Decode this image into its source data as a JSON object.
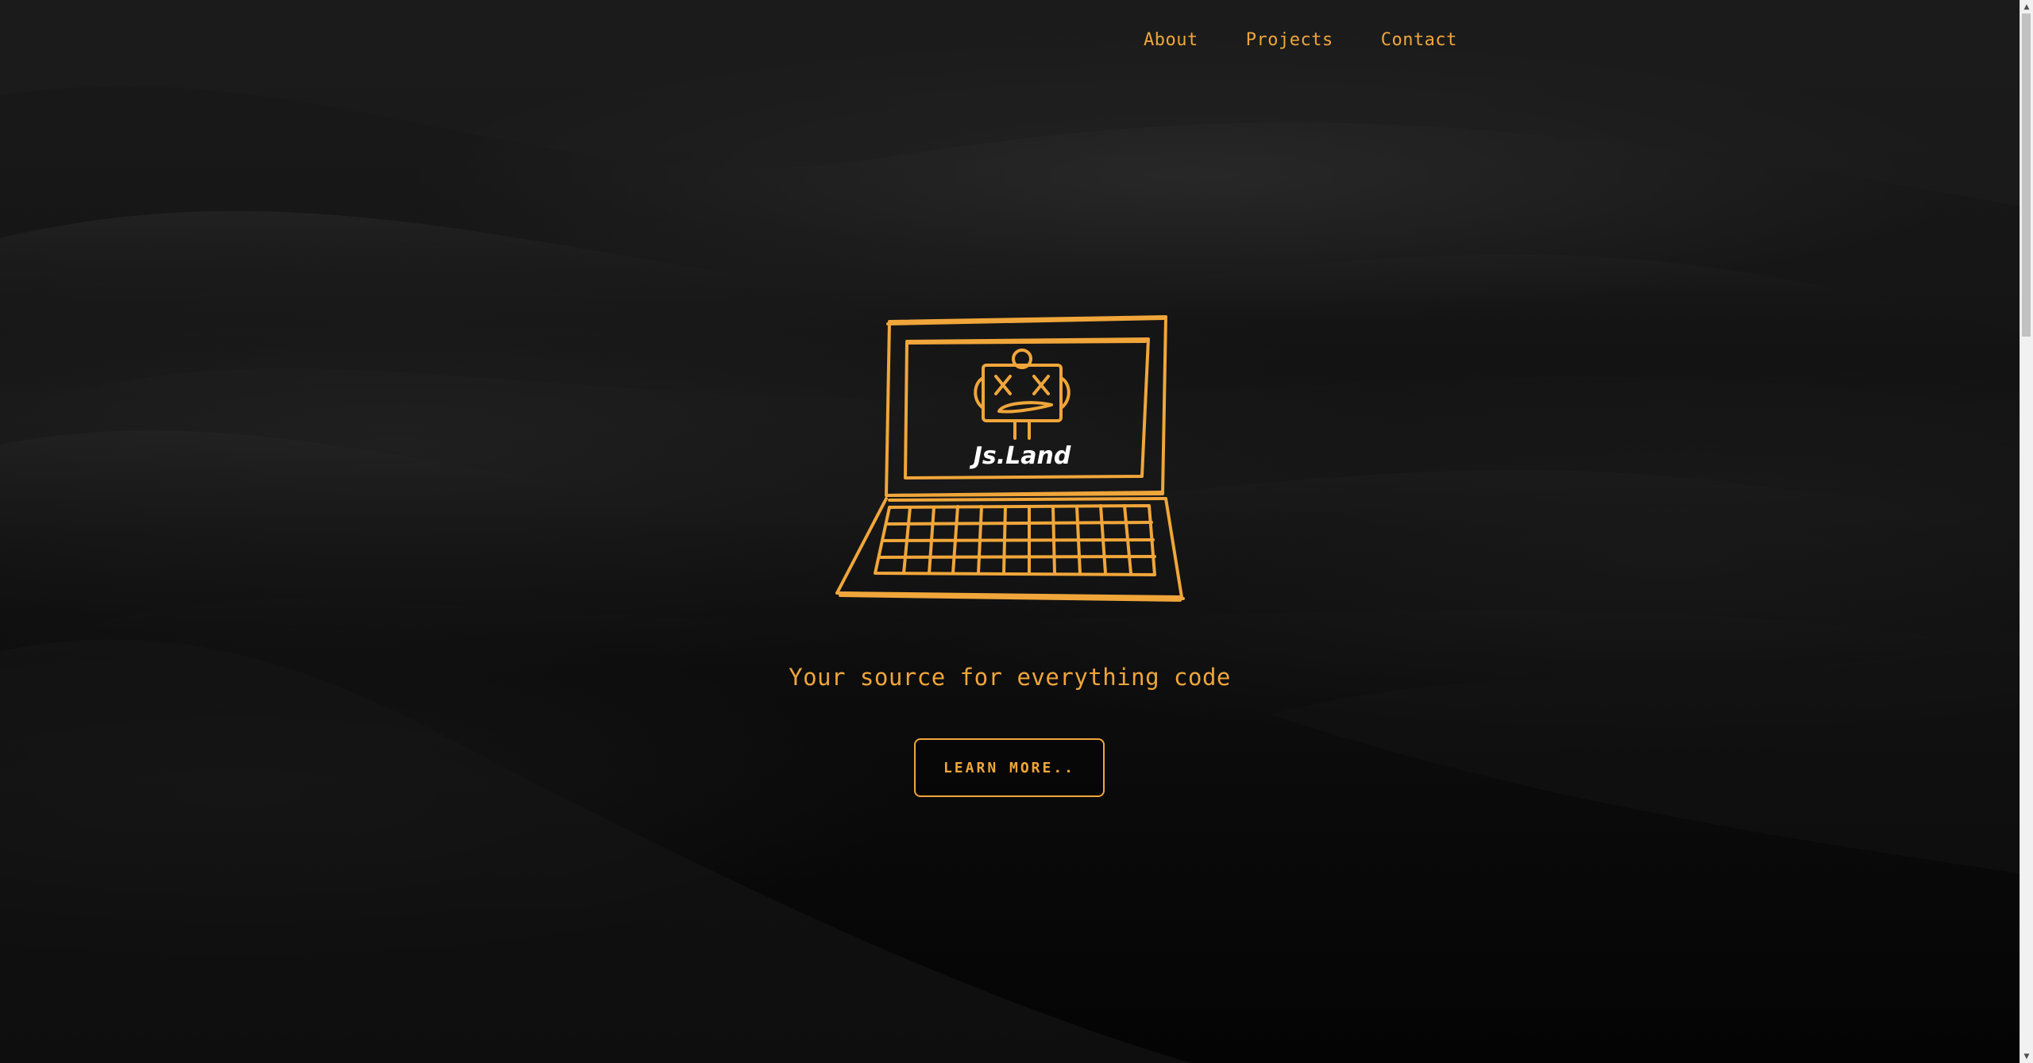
{
  "nav": {
    "items": [
      {
        "label": "About"
      },
      {
        "label": "Projects"
      },
      {
        "label": "Contact"
      }
    ]
  },
  "logo": {
    "text": "Js.Land",
    "icon": "laptop-robot-icon"
  },
  "hero": {
    "tagline": "Your source for everything code",
    "button_label": "LEARN MORE.."
  },
  "colors": {
    "accent": "#f0a63a",
    "background": "#0c0c0c",
    "logo_text": "#ffffff"
  }
}
